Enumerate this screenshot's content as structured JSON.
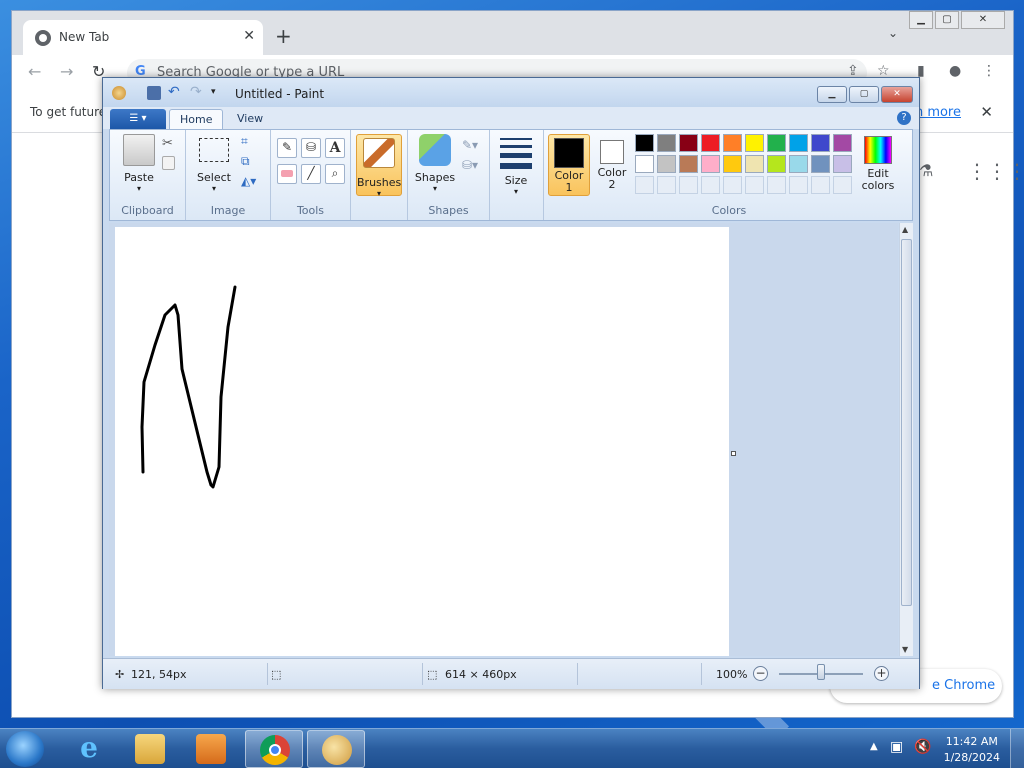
{
  "chrome": {
    "tab_title": "New Tab",
    "tab_close": "✕",
    "new_tab": "+",
    "omnibox_placeholder": "Search Google or type a URL",
    "info_message": "To get future",
    "info_link": "rn more",
    "info_close": "✕",
    "customize_label": "e Chrome"
  },
  "paint": {
    "window_title": "Untitled - Paint",
    "tabs": [
      "Home",
      "View"
    ],
    "groups": {
      "clipboard": {
        "label": "Clipboard",
        "paste": "Paste"
      },
      "image": {
        "label": "Image",
        "select": "Select"
      },
      "tools": {
        "label": "Tools"
      },
      "brushes": {
        "label": "Brushes"
      },
      "shapes": {
        "label": "Shapes",
        "shapes": "Shapes"
      },
      "size": {
        "label": "Size"
      },
      "colors": {
        "label": "Colors",
        "color1": "Color 1",
        "color1_line1": "Color",
        "color1_line2": "1",
        "color2_line1": "Color",
        "color2_line2": "2",
        "edit_line1": "Edit",
        "edit_line2": "colors"
      }
    },
    "color1_value": "#000000",
    "color2_value": "#ffffff",
    "palette": [
      "#000000",
      "#7f7f7f",
      "#880015",
      "#ed1c24",
      "#ff7f27",
      "#fff200",
      "#22b14c",
      "#00a2e8",
      "#3f48cc",
      "#a349a4",
      "#ffffff",
      "#c3c3c3",
      "#b97a57",
      "#ffaec9",
      "#ffc90e",
      "#efe4b0",
      "#b5e61d",
      "#99d9ea",
      "#7092be",
      "#c8bfe7"
    ],
    "status": {
      "cursor_pos": "121, 54px",
      "selection_size": "",
      "canvas_size": "614 × 460px",
      "zoom": "100%"
    },
    "zoom_level": 0.5
  },
  "taskbar": {
    "time": "11:42 AM",
    "date": "1/28/2024"
  }
}
